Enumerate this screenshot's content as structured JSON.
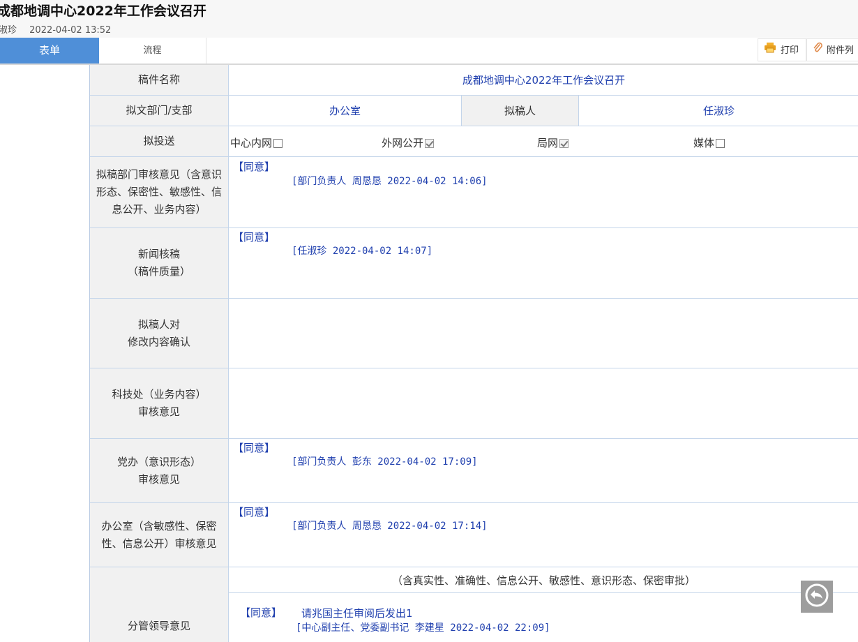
{
  "header": {
    "title": "成都地调中心2022年工作会议召开",
    "author": "淑珍",
    "time": "2022-04-02 13:52"
  },
  "tabs": [
    {
      "label": "表单",
      "active": true
    },
    {
      "label": "流程",
      "active": false
    }
  ],
  "toolbar": {
    "print_label": "打印",
    "print_icon": "printer-icon",
    "attach_label": "附件列",
    "attach_icon": "paperclip-icon"
  },
  "colors": {
    "active_tab": "#4f8fd8",
    "value_text": "#1f3fae",
    "label_bg": "#f1f1f1",
    "border": "#c4d5ea"
  },
  "form": {
    "draft_name": {
      "label": "稿件名称",
      "value": "成都地调中心2022年工作会议召开"
    },
    "dept": {
      "label": "拟文部门/支部",
      "value": "办公室",
      "drafter_label": "拟稿人",
      "drafter_value": "任淑珍"
    },
    "delivery": {
      "label": "拟投送",
      "options": [
        {
          "label": "中心内网",
          "checked": false
        },
        {
          "label": "外网公开",
          "checked": true
        },
        {
          "label": "局网",
          "checked": true
        },
        {
          "label": "媒体",
          "checked": false
        }
      ]
    },
    "dept_review": {
      "label": "拟稿部门审核意见（含意识形态、保密性、敏感性、信息公开、业务内容）",
      "opinion": "【同意】",
      "signature": "[部门负责人 周恳恳 2022-04-02 14:06]"
    },
    "news_review": {
      "label_line1": "新闻核稿",
      "label_line2": "（稿件质量）",
      "opinion": "【同意】",
      "signature": "[任淑珍 2022-04-02 14:07]"
    },
    "drafter_confirm": {
      "label_line1": "拟稿人对",
      "label_line2": "修改内容确认"
    },
    "tech_review": {
      "label_line1": "科技处（业务内容）",
      "label_line2": "审核意见"
    },
    "party_review": {
      "label_line1": "党办（意识形态）",
      "label_line2": "审核意见",
      "opinion": "【同意】",
      "signature": "[部门负责人 彭东 2022-04-02 17:09]"
    },
    "office_review": {
      "label": "办公室（含敏感性、保密性、信息公开）审核意见",
      "opinion": "【同意】",
      "signature": "[部门负责人 周恳恳 2022-04-02 17:14]"
    },
    "leader_review": {
      "label": "分管领导意见",
      "note": "（含真实性、准确性、信息公开、敏感性、意识形态、保密审批）",
      "opinion": "【同意】",
      "remark": "请兆国主任审阅后发出1",
      "signature": "[中心副主任、党委副书记 李建星 2022-04-02 22:09]"
    }
  },
  "floating": {
    "back_icon": "reply-arrow-icon"
  }
}
